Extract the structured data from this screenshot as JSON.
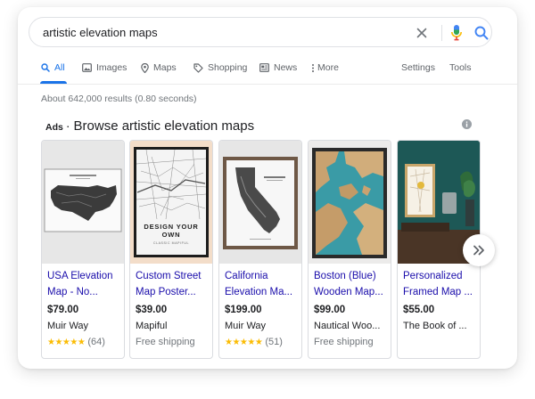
{
  "search": {
    "query": "artistic elevation maps",
    "clear_icon": "close-icon",
    "voice_icon": "mic-icon",
    "search_icon": "search-icon"
  },
  "tabs": {
    "all": "All",
    "images": "Images",
    "maps": "Maps",
    "shopping": "Shopping",
    "news": "News",
    "more": "More",
    "settings": "Settings",
    "tools": "Tools"
  },
  "results_stats": "About 642,000 results (0.80 seconds)",
  "ads": {
    "label": "Ads",
    "separator": "·",
    "title": "Browse artistic elevation maps"
  },
  "products": [
    {
      "title_line1": "USA Elevation",
      "title_line2": "Map - No...",
      "price": "$79.00",
      "seller": "Muir Way",
      "rating_stars": "★★★★★",
      "rating_count": "(64)"
    },
    {
      "title_line1": "Custom Street",
      "title_line2": "Map Poster...",
      "price": "$39.00",
      "seller": "Mapiful",
      "shipping": "Free shipping",
      "poster_line1": "DESIGN YOUR",
      "poster_line2": "OWN",
      "poster_line3": "CLASSIC MAPIFUL"
    },
    {
      "title_line1": "California",
      "title_line2": "Elevation Ma...",
      "price": "$199.00",
      "seller": "Muir Way",
      "rating_stars": "★★★★★",
      "rating_count": "(51)"
    },
    {
      "title_line1": "Boston (Blue)",
      "title_line2": "Wooden Map...",
      "price": "$99.00",
      "seller": "Nautical Woo...",
      "shipping": "Free shipping"
    },
    {
      "title_line1": "Personalized",
      "title_line2": "Framed Map ...",
      "price": "$55.00",
      "seller": "The Book of ..."
    }
  ],
  "colors": {
    "link": "#1a0dab",
    "accent": "#1a73e8",
    "star": "#fbbc04",
    "muted": "#70757a"
  }
}
